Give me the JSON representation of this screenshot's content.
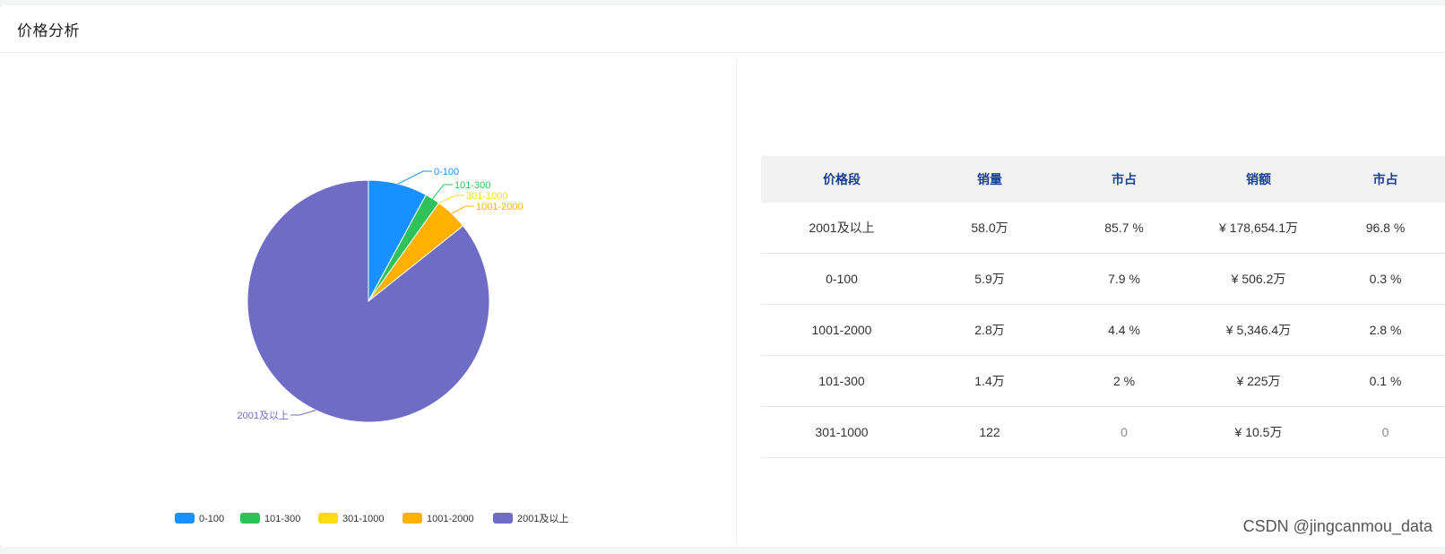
{
  "panel": {
    "title": "价格分析"
  },
  "chart_data": {
    "type": "pie",
    "labels": [
      "0-100",
      "101-300",
      "301-1000",
      "1001-2000",
      "2001及以上"
    ],
    "values": [
      7.9,
      2,
      0,
      4.4,
      85.7
    ],
    "colors": [
      "#1890ff",
      "#2fc25b",
      "#fadb14",
      "#ffb000",
      "#6f6cc6"
    ],
    "legend": {
      "position": "bottom",
      "entries": [
        "0-100",
        "101-300",
        "301-1000",
        "1001-2000",
        "2001及以上"
      ]
    }
  },
  "table": {
    "headers": [
      "价格段",
      "销量",
      "市占",
      "销额",
      "市占"
    ],
    "rows": [
      [
        "2001及以上",
        "58.0万",
        "85.7 %",
        "¥ 178,654.1万",
        "96.8 %"
      ],
      [
        "0-100",
        "5.9万",
        "7.9 %",
        "¥ 506.2万",
        "0.3 %"
      ],
      [
        "1001-2000",
        "2.8万",
        "4.4 %",
        "¥ 5,346.4万",
        "2.8 %"
      ],
      [
        "101-300",
        "1.4万",
        "2 %",
        "¥ 225万",
        "0.1 %"
      ],
      [
        "301-1000",
        "122",
        "0",
        "¥ 10.5万",
        "0"
      ]
    ]
  },
  "watermark": "CSDN @jingcanmou_data"
}
